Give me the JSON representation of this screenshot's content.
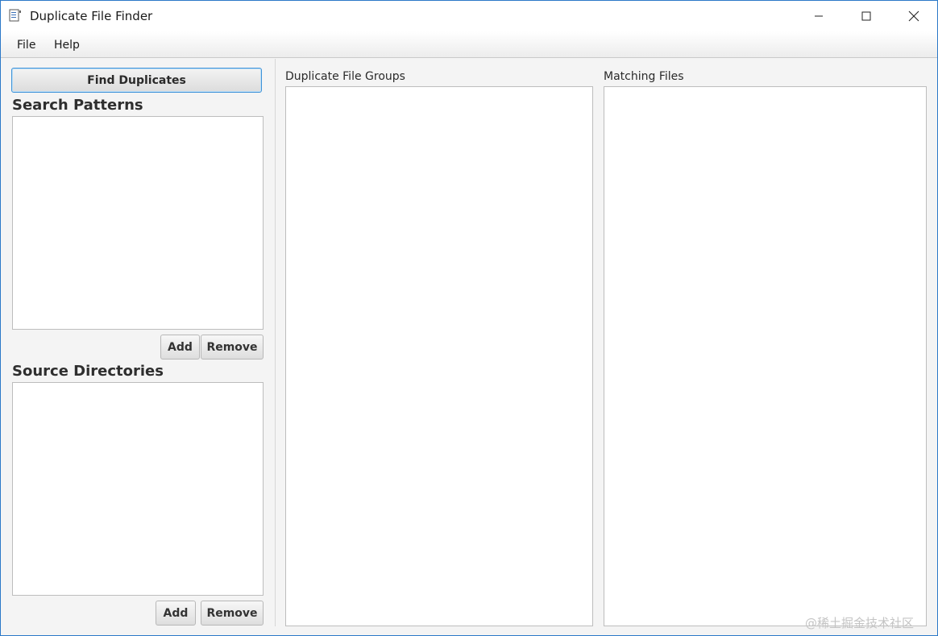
{
  "window": {
    "title": "Duplicate File Finder",
    "accent_color": "#2b78c8"
  },
  "menu": {
    "items": [
      {
        "label": "File"
      },
      {
        "label": "Help"
      }
    ]
  },
  "left_panel": {
    "find_button_label": "Find Duplicates",
    "search_patterns": {
      "heading": "Search Patterns",
      "items": [],
      "add_label": "Add",
      "remove_label": "Remove"
    },
    "source_directories": {
      "heading": "Source Directories",
      "items": [],
      "add_label": "Add",
      "remove_label": "Remove"
    }
  },
  "groups_panel": {
    "label": "Duplicate File Groups",
    "items": []
  },
  "files_panel": {
    "label": "Matching Files",
    "items": []
  },
  "watermark": "@稀土掘金技术社区"
}
